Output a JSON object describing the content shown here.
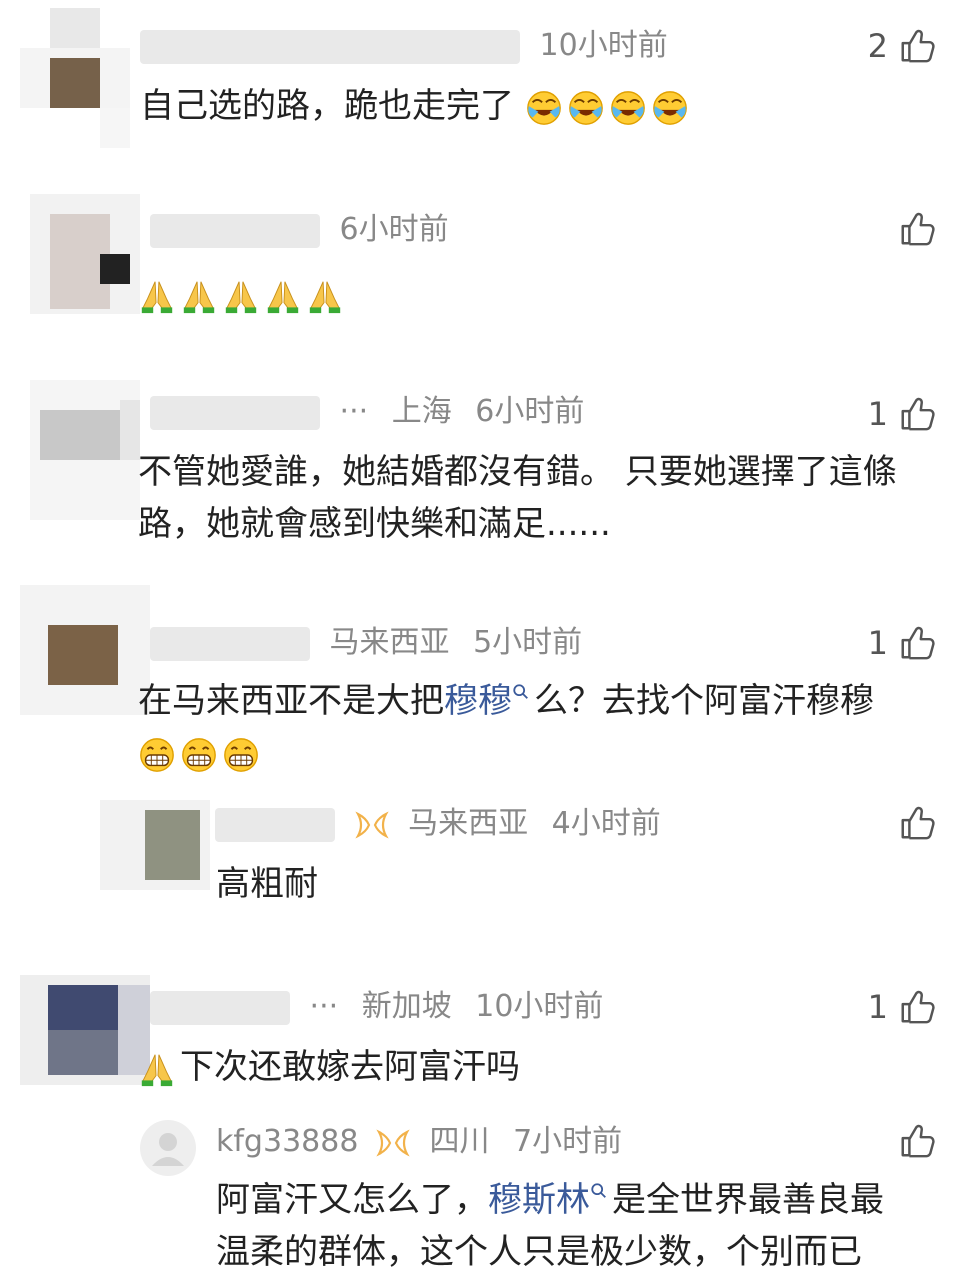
{
  "comments": [
    {
      "time": "10小时前",
      "likes": "2",
      "text": "自己选的路，跪也走完了",
      "emoji": [
        "cry-laugh",
        "cry-laugh",
        "cry-laugh",
        "cry-laugh"
      ]
    },
    {
      "time": "6小时前",
      "likes": "",
      "text": "",
      "emoji": [
        "pray",
        "pray",
        "pray",
        "pray",
        "pray"
      ]
    },
    {
      "ellipsis": "···",
      "location": "上海",
      "time": "6小时前",
      "likes": "1",
      "text": "不管她愛誰，她結婚都沒有錯。 只要她選擇了這條路，她就會感到快樂和滿足......"
    },
    {
      "location": "马来西亚",
      "time": "5小时前",
      "likes": "1",
      "text_before": "在马来西亚不是大把",
      "link": "穆穆",
      "text_after": "么？去找个阿富汗穆穆",
      "emoji": [
        "grin",
        "grin",
        "grin"
      ]
    },
    {
      "reply": true,
      "location": "马来西亚",
      "time": "4小时前",
      "likes": "",
      "text": "高粗耐"
    },
    {
      "ellipsis": "···",
      "location": "新加坡",
      "time": "10小时前",
      "likes": "1",
      "text": "下次还敢嫁去阿富汗吗",
      "emoji": [
        "pray"
      ]
    },
    {
      "reply": true,
      "username": "kfg33888",
      "location": "四川",
      "time": "7小时前",
      "likes": "",
      "text_before": "阿富汗又怎么了，",
      "link": "穆斯林",
      "text_after_line1": "是全世界最善良最",
      "text_line2": "温柔的群体，这个人只是极少数，个别而已"
    }
  ],
  "colors": {
    "link": "#3a5a9a",
    "meta": "#888888",
    "badge": "#f2b24a",
    "text": "#222222"
  },
  "icons": {
    "like": "thumb-up-icon",
    "search": "search-icon",
    "badge": "vip-badge-icon"
  }
}
